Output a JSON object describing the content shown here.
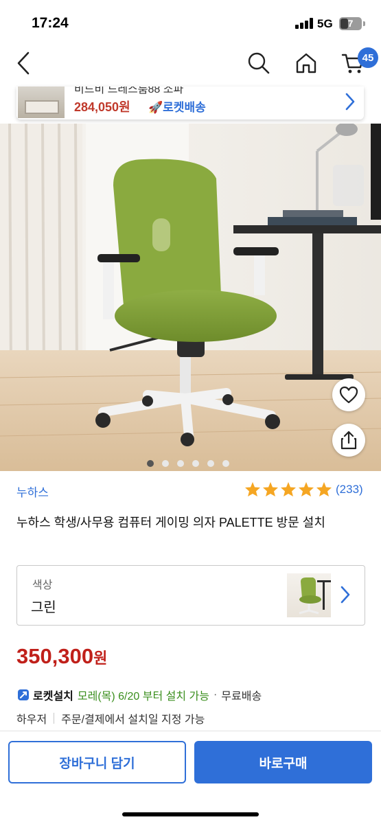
{
  "status_bar": {
    "time": "17:24",
    "network": "5G",
    "battery": "7"
  },
  "nav": {
    "cart_count": "45",
    "icons": [
      "back-arrow-icon",
      "search-icon",
      "home-icon",
      "cart-icon"
    ]
  },
  "related_product": {
    "title_partial": "비드비 드레스룸88 소파",
    "price": "284,050원",
    "shipping": "로켓배송"
  },
  "gallery": {
    "image_count": 6,
    "active_index": 0
  },
  "product": {
    "brand": "누하스",
    "rating_stars": 5,
    "review_count": "(233)",
    "title": "누하스 학생/사무용 컴퓨터 게이밍 의자 PALETTE 방문 설치"
  },
  "option": {
    "label": "색상",
    "value": "그린"
  },
  "price": {
    "amount": "350,300",
    "unit": "원"
  },
  "delivery": {
    "badge": "로켓설치",
    "date": "모레(목) 6/20 부터 설치 가능",
    "separator": "·",
    "fee": "무료배송"
  },
  "sub_info": {
    "seller": "하우저",
    "note": "주문/결제에서 설치일 지정 가능"
  },
  "buttons": {
    "add_to_cart": "장바구니 담기",
    "buy_now": "바로구매"
  },
  "colors": {
    "accent": "#2f6fd8",
    "price": "#c0201a",
    "delivery_date": "#3a8e1d",
    "star": "#f5a623"
  }
}
